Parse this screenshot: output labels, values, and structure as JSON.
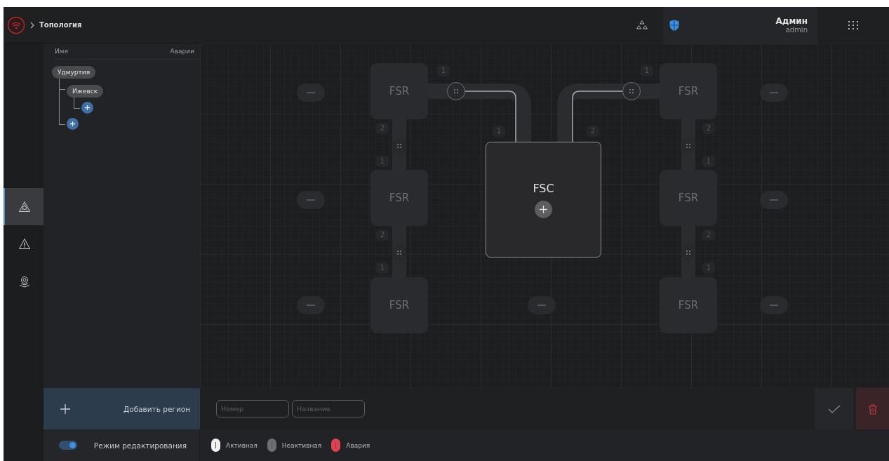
{
  "topbar": {
    "breadcrumb": "Топология",
    "user": {
      "name": "Админ",
      "login": "admin"
    }
  },
  "rail": [
    {
      "kind": "topology",
      "selected": true
    },
    {
      "kind": "alarms",
      "selected": false
    },
    {
      "kind": "location",
      "selected": false
    }
  ],
  "sidebar": {
    "columns": [
      "Имя",
      "Аварии"
    ],
    "tree": [
      {
        "kind": "region",
        "label": "Удмуртия",
        "children": [
          {
            "kind": "region",
            "label": "Ижевск",
            "children": [
              {
                "kind": "add"
              }
            ]
          },
          {
            "kind": "add"
          }
        ]
      }
    ]
  },
  "canvas": {
    "controller": {
      "label": "FSC"
    },
    "nodes": [
      {
        "label": "FSR"
      },
      {
        "label": "FSR"
      },
      {
        "label": "FSR"
      },
      {
        "label": "FSR"
      },
      {
        "label": "FSR"
      },
      {
        "label": "FSR"
      }
    ],
    "port_labels": [
      "1",
      "1",
      "2",
      "1",
      "2",
      "2",
      "1",
      "1",
      "2",
      "2",
      "1",
      "1"
    ]
  },
  "form": {
    "add_button": "Добавить регион",
    "fields": [
      {
        "placeholder": "Номер"
      },
      {
        "placeholder": "Название"
      }
    ]
  },
  "edit_mode": {
    "label": "Режим редактирования",
    "on": true
  },
  "legend": [
    {
      "label": "Активная",
      "color": "#f2f2f2"
    },
    {
      "label": "Неактивная",
      "color": "#6c6e71"
    },
    {
      "label": "Авария",
      "color": "#e2404f"
    }
  ]
}
